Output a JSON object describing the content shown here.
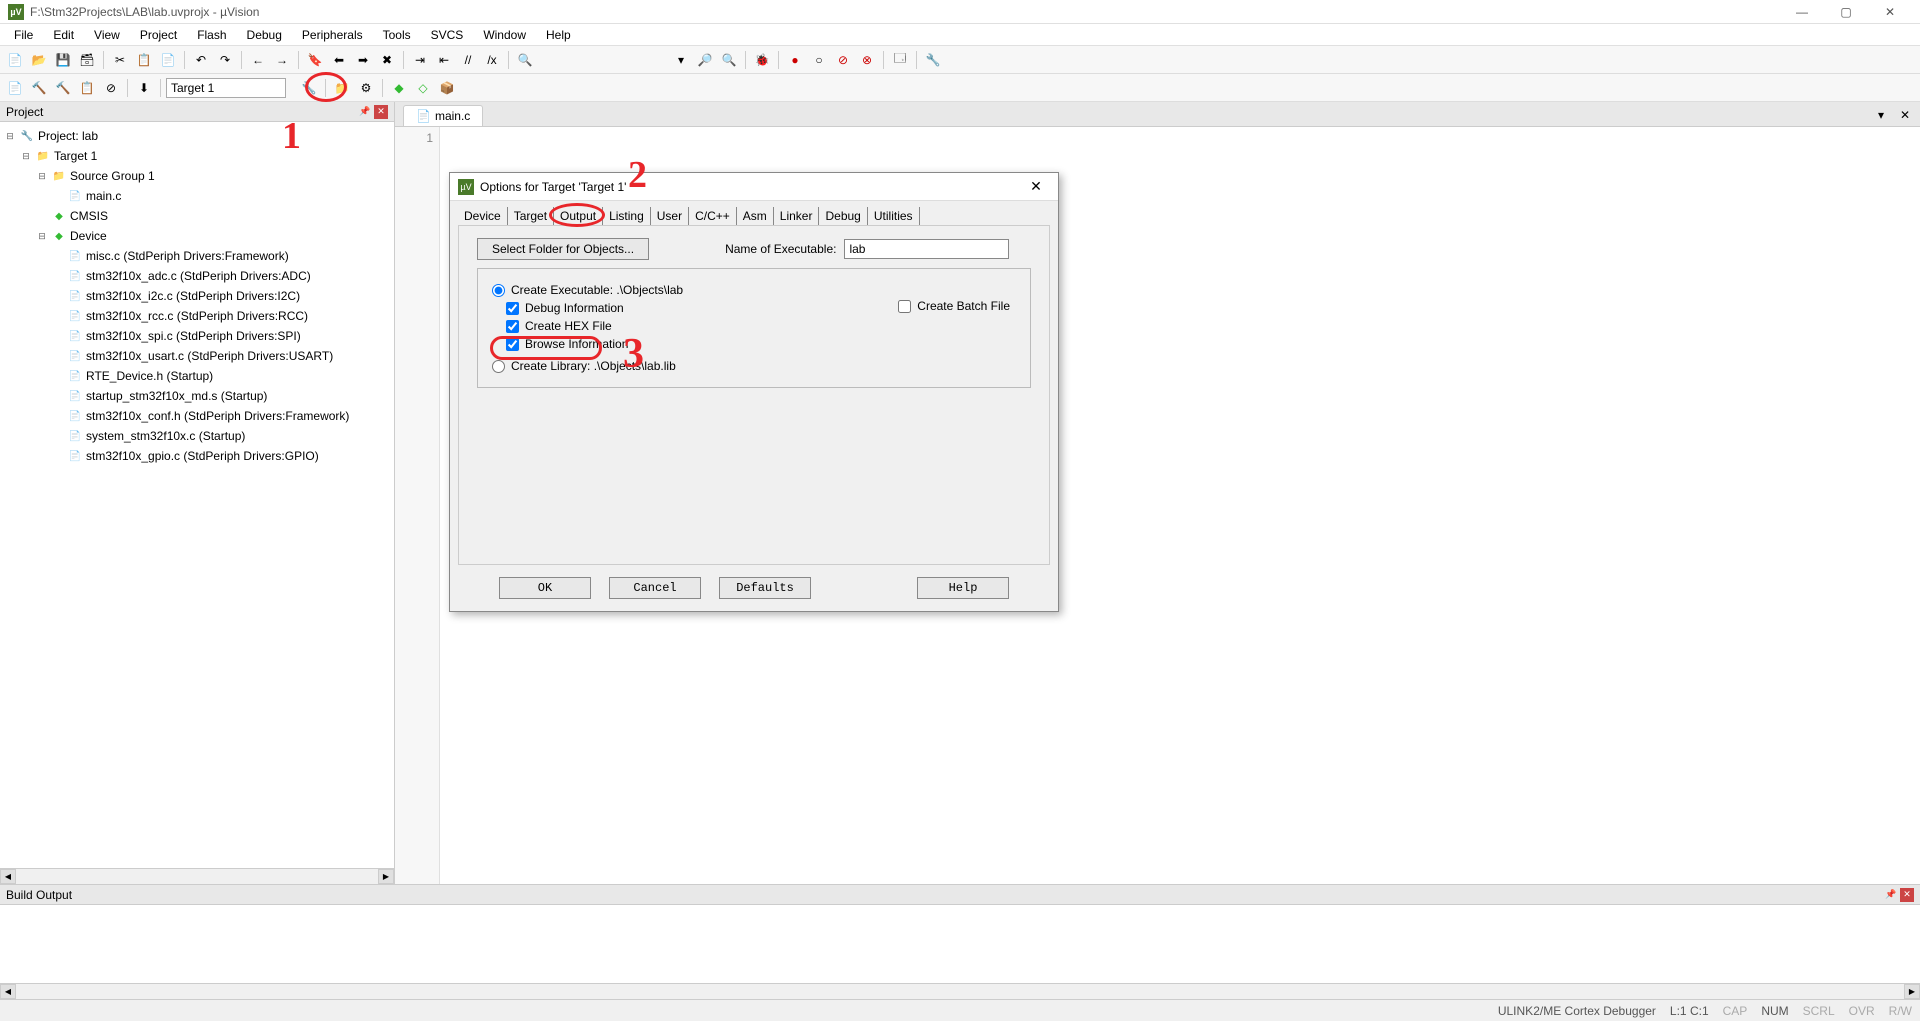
{
  "titlebar": {
    "path": "F:\\Stm32Projects\\LAB\\lab.uvprojx - µVision"
  },
  "menu": [
    "File",
    "Edit",
    "View",
    "Project",
    "Flash",
    "Debug",
    "Peripherals",
    "Tools",
    "SVCS",
    "Window",
    "Help"
  ],
  "toolbar2": {
    "target": "Target 1"
  },
  "project_panel": {
    "title": "Project"
  },
  "tree": {
    "root": "Project: lab",
    "target": "Target 1",
    "group": "Source Group 1",
    "main": "main.c",
    "cmsis": "CMSIS",
    "device": "Device",
    "files": [
      "misc.c (StdPeriph Drivers:Framework)",
      "stm32f10x_adc.c (StdPeriph Drivers:ADC)",
      "stm32f10x_i2c.c (StdPeriph Drivers:I2C)",
      "stm32f10x_rcc.c (StdPeriph Drivers:RCC)",
      "stm32f10x_spi.c (StdPeriph Drivers:SPI)",
      "stm32f10x_usart.c (StdPeriph Drivers:USART)",
      "RTE_Device.h (Startup)",
      "startup_stm32f10x_md.s (Startup)",
      "stm32f10x_conf.h (StdPeriph Drivers:Framework)",
      "system_stm32f10x.c (Startup)",
      "stm32f10x_gpio.c (StdPeriph Drivers:GPIO)"
    ]
  },
  "editor": {
    "tab": "main.c",
    "line1": "1"
  },
  "build_output": {
    "title": "Build Output"
  },
  "statusbar": {
    "debugger": "ULINK2/ME Cortex Debugger",
    "pos": "L:1 C:1",
    "caps": "CAP",
    "num": "NUM",
    "scrl": "SCRL",
    "ovr": "OVR",
    "rw": "R/W"
  },
  "dialog": {
    "title": "Options for Target 'Target 1'",
    "tabs": [
      "Device",
      "Target",
      "Output",
      "Listing",
      "User",
      "C/C++",
      "Asm",
      "Linker",
      "Debug",
      "Utilities"
    ],
    "select_folder": "Select Folder for Objects...",
    "name_label": "Name of Executable:",
    "name_value": "lab",
    "create_exe": "Create Executable:   .\\Objects\\lab",
    "debug_info": "Debug Information",
    "create_hex": "Create HEX File",
    "browse_info": "Browse Information",
    "create_batch": "Create Batch File",
    "create_lib": "Create Library:   .\\Objects\\lab.lib",
    "ok": "OK",
    "cancel": "Cancel",
    "defaults": "Defaults",
    "help": "Help"
  },
  "annotations": {
    "n1": "1",
    "n2": "2",
    "n3": "3"
  }
}
